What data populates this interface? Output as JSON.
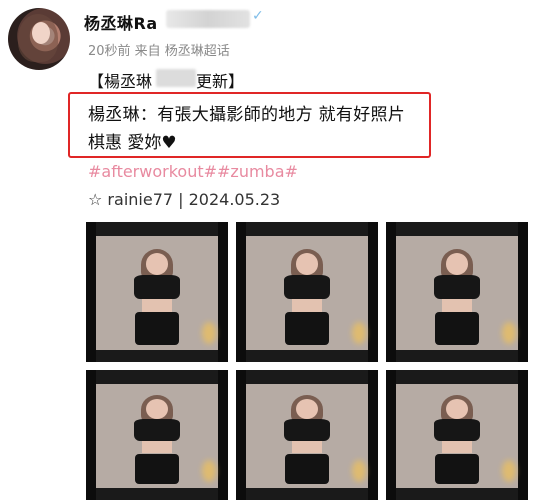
{
  "post": {
    "username": "杨丞琳Ra",
    "meta": "20秒前 来自 杨丞琳超话",
    "tagline_prefix": "【楊丞琳",
    "tagline_suffix": "更新】",
    "quote_line1": "楊丞琳：有張大攝影師的地方 就有好照片",
    "quote_line2": "棋惠 愛妳♥",
    "hashtags": "#afterworkout##zumba#",
    "credit": "☆ rainie77 | 2024.05.23"
  },
  "icons": {
    "vip_badge": "verified-badge-icon",
    "avatar": "avatar-image"
  },
  "colors": {
    "highlight_border": "#e02626",
    "hashtag": "#e88aa0"
  },
  "photos": [
    {
      "name": "photo-1"
    },
    {
      "name": "photo-2"
    },
    {
      "name": "photo-3"
    },
    {
      "name": "photo-4"
    },
    {
      "name": "photo-5"
    },
    {
      "name": "photo-6"
    }
  ]
}
